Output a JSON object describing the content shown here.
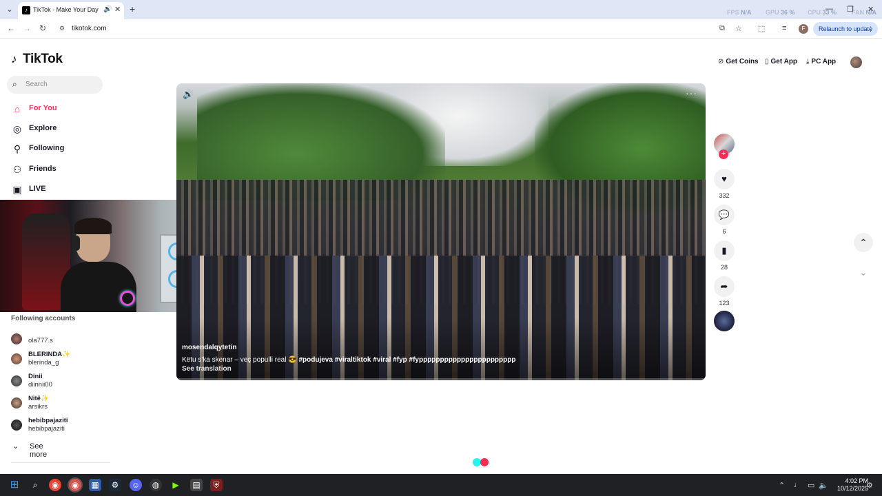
{
  "browser": {
    "tab_title": "TikTok - Make Your Day",
    "url": "tikotok.com",
    "relaunch_label": "Relaunch to update",
    "profile_initial": "F",
    "overlay": [
      {
        "label": "FPS",
        "value": "N/A"
      },
      {
        "label": "GPU",
        "value": "36 %"
      },
      {
        "label": "CPU",
        "value": "33 %"
      },
      {
        "label": "FAN",
        "value": "N/A"
      }
    ]
  },
  "tiktok": {
    "logo_text": "TikTok",
    "search_placeholder": "Search",
    "nav": [
      {
        "label": "For You",
        "icon": "home-icon",
        "active": true
      },
      {
        "label": "Explore",
        "icon": "compass-icon",
        "active": false
      },
      {
        "label": "Following",
        "icon": "following-icon",
        "active": false
      },
      {
        "label": "Friends",
        "icon": "friends-icon",
        "active": false
      },
      {
        "label": "LIVE",
        "icon": "live-icon",
        "active": false
      }
    ],
    "following_title": "Following accounts",
    "accounts": [
      {
        "name": "",
        "handle": "ola777.s"
      },
      {
        "name": "BLERINDA✨",
        "handle": "blerinda_g"
      },
      {
        "name": "Dinii",
        "handle": "diinnii00"
      },
      {
        "name": "Nitë✨",
        "handle": "arsikrs"
      },
      {
        "name": "hebibpajaziti",
        "handle": "hebibpajaziti"
      }
    ],
    "see_more": "See more",
    "header": {
      "get_coins": "Get Coins",
      "get_app": "Get App",
      "pc_app": "PC App"
    },
    "video": {
      "author": "mosendalqytetin",
      "caption_text": "Këtu s'ka skenar – veç populli real 😎",
      "hashtags": "#podujeva  #viraltiktok  #viral  #fyp  #fyppppppppppppppppppppppp",
      "see_translation": "See translation",
      "progress": 0.0
    },
    "actions": {
      "likes": "332",
      "comments": "6",
      "saves": "28",
      "shares": "123"
    }
  },
  "taskbar": {
    "time": "4:02 PM",
    "date": "10/12/2025"
  },
  "colors": {
    "accent": "#fe2c55",
    "loader_a": "#25f4ee",
    "loader_b": "#fe2c55"
  }
}
